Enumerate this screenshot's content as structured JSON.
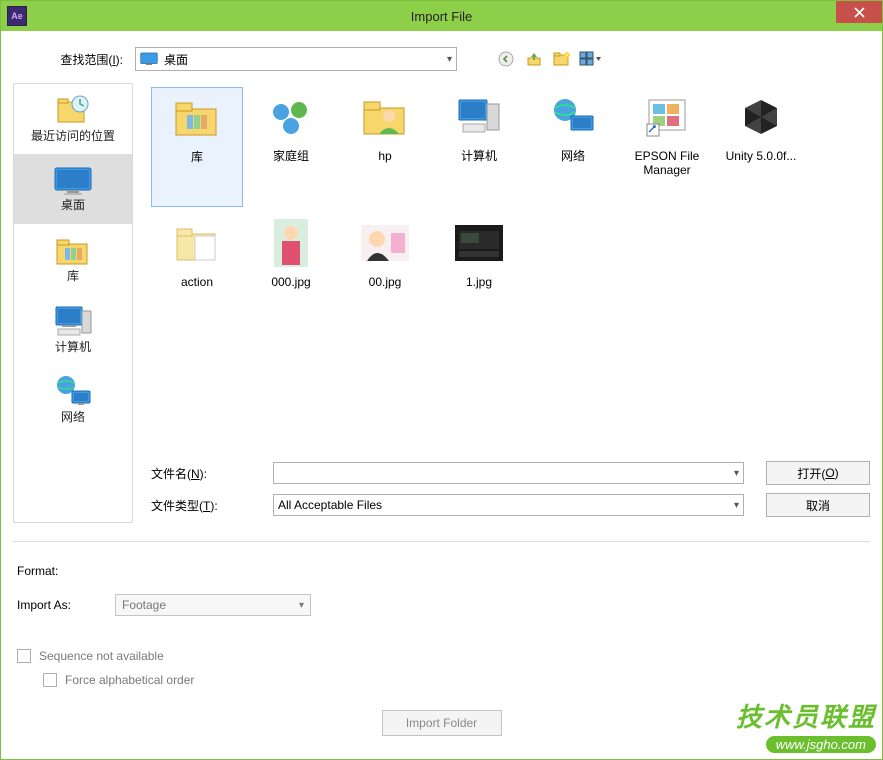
{
  "window": {
    "title": "Import File",
    "app_icon_text": "Ae"
  },
  "lookin": {
    "label_pre": "查找范围(",
    "label_key": "I",
    "label_post": "):",
    "value": "桌面"
  },
  "nav_icons": [
    "back-icon",
    "up-icon",
    "new-folder-icon",
    "view-menu-icon"
  ],
  "sidebar": {
    "items": [
      {
        "label": "最近访问的位置",
        "icon": "recent-icon"
      },
      {
        "label": "桌面",
        "icon": "desktop-icon",
        "selected": true
      },
      {
        "label": "库",
        "icon": "libraries-icon"
      },
      {
        "label": "计算机",
        "icon": "computer-icon"
      },
      {
        "label": "网络",
        "icon": "network-icon"
      }
    ]
  },
  "files": {
    "row1": [
      {
        "label": "库",
        "icon": "folder-lib",
        "selected": true
      },
      {
        "label": "家庭组",
        "icon": "homegroup"
      },
      {
        "label": "hp",
        "icon": "user-folder"
      },
      {
        "label": "计算机",
        "icon": "computer"
      },
      {
        "label": "网络",
        "icon": "network"
      },
      {
        "label": "EPSON File Manager",
        "icon": "shortcut"
      },
      {
        "label": "Unity 5.0.0f...",
        "icon": "unity"
      }
    ],
    "row2": [
      {
        "label": "action",
        "icon": "folder"
      },
      {
        "label": "000.jpg",
        "icon": "photo1"
      },
      {
        "label": "00.jpg",
        "icon": "photo2"
      },
      {
        "label": "1.jpg",
        "icon": "dark"
      }
    ]
  },
  "form": {
    "filename_label_pre": "文件名(",
    "filename_key": "N",
    "filename_label_post": "):",
    "filetype_label_pre": "文件类型(",
    "filetype_key": "T",
    "filetype_label_post": "):",
    "filetype_value": "All Acceptable Files",
    "open_btn_pre": "打开(",
    "open_key": "O",
    "open_btn_post": ")",
    "cancel_btn": "取消"
  },
  "meta": {
    "format_label": "Format:",
    "import_as_label": "Import As:",
    "import_as_value": "Footage",
    "seq_label": "Sequence not available",
    "alpha_label": "Force alphabetical order",
    "import_folder_btn": "Import Folder"
  },
  "watermark": {
    "line1": "技术员联盟",
    "line2": "www.jsgho.com"
  }
}
